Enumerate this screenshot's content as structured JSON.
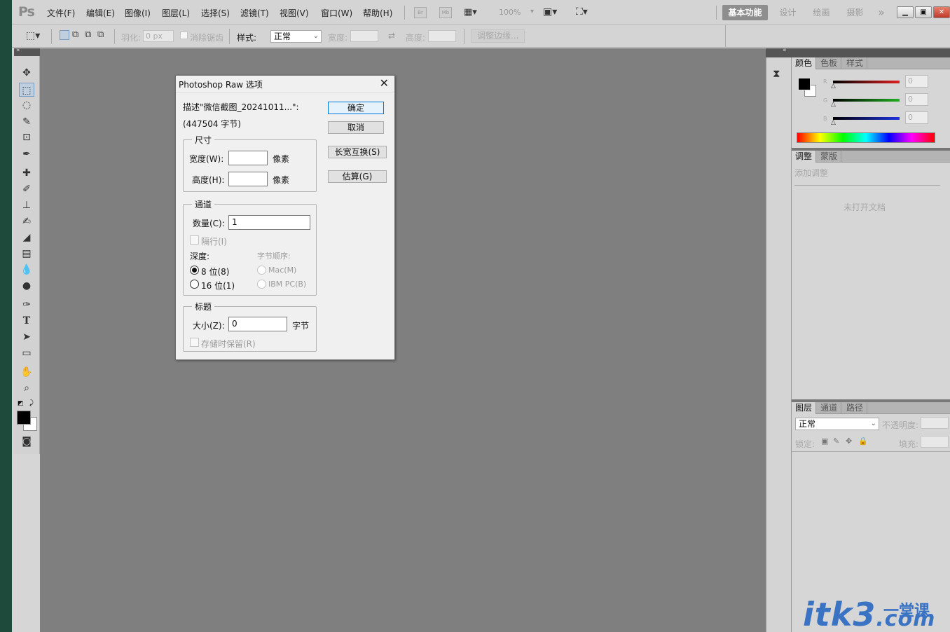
{
  "menubar": {
    "logo": "Ps",
    "items": [
      "文件(F)",
      "编辑(E)",
      "图像(I)",
      "图层(L)",
      "选择(S)",
      "滤镜(T)",
      "视图(V)",
      "窗口(W)",
      "帮助(H)"
    ],
    "bridge_label": "Br",
    "mini_label": "Mb",
    "zoom": "100%",
    "workspaces": [
      "基本功能",
      "设计",
      "绘画",
      "摄影"
    ],
    "more": "»"
  },
  "options": {
    "feather_label": "羽化:",
    "feather_value": "0 px",
    "antialias_label": "消除锯齿",
    "style_label": "样式:",
    "style_value": "正常",
    "width_label": "宽度:",
    "height_label": "高度:",
    "refine_label": "调整边缘..."
  },
  "color_panel": {
    "tabs": [
      "颜色",
      "色板",
      "样式"
    ],
    "channels": [
      {
        "label": "R",
        "value": "0",
        "color": "#e02020"
      },
      {
        "label": "G",
        "value": "0",
        "color": "#20b020"
      },
      {
        "label": "B",
        "value": "0",
        "color": "#2030e0"
      }
    ]
  },
  "adjust_panel": {
    "tabs": [
      "调整",
      "蒙版"
    ],
    "add_label": "添加调整",
    "empty_label": "未打开文档"
  },
  "layers_panel": {
    "tabs": [
      "图层",
      "通道",
      "路径"
    ],
    "blend_mode": "正常",
    "opacity_label": "不透明度:",
    "lock_label": "锁定:",
    "fill_label": "填充:"
  },
  "dialog": {
    "title": "Photoshop Raw 选项",
    "description": "描述\"微信截图_20241011...\":",
    "bytes": "(447504 字节)",
    "size_group": "尺寸",
    "width_label": "宽度(W):",
    "height_label": "高度(H):",
    "pixel_unit": "像素",
    "channel_group": "通道",
    "count_label": "数量(C):",
    "count_value": "1",
    "interleave_label": "隔行(I)",
    "depth_label": "深度:",
    "byte_order_label": "字节顺序:",
    "depth8": "8 位(8)",
    "depth16": "16 位(1)",
    "mac": "Mac(M)",
    "ibm": "IBM PC(B)",
    "header_group": "标题",
    "size_label": "大小(Z):",
    "size_value": "0",
    "size_unit": "字节",
    "retain_label": "存储时保留(R)",
    "ok": "确定",
    "cancel": "取消",
    "swap": "长宽互换(S)",
    "guess": "估算(G)"
  },
  "watermark": {
    "main": "itk3",
    "suffix": ".com",
    "cn": "一堂课"
  }
}
